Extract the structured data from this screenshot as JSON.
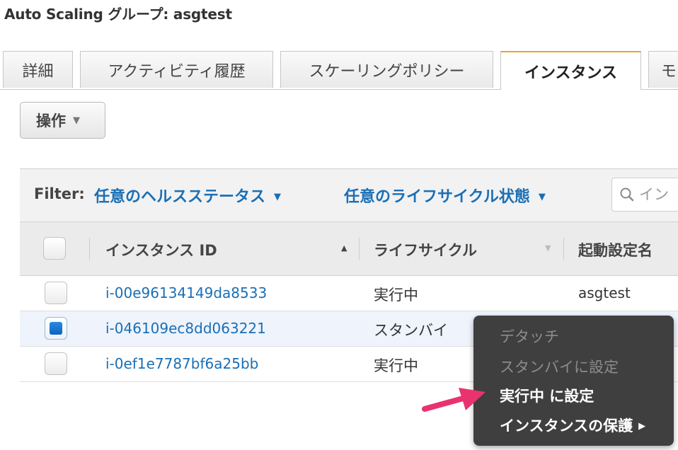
{
  "page": {
    "title": "Auto Scaling グループ: asgtest"
  },
  "tabs": [
    {
      "label": "詳細",
      "active": false
    },
    {
      "label": "アクティビティ履歴",
      "active": false
    },
    {
      "label": "スケーリングポリシー",
      "active": false
    },
    {
      "label": "インスタンス",
      "active": true
    },
    {
      "label": "モ",
      "active": false
    }
  ],
  "toolbar": {
    "actions_label": "操作"
  },
  "filter": {
    "label": "Filter:",
    "health_status": "任意のヘルスステータス",
    "lifecycle_state": "任意のライフサイクル状態",
    "search_placeholder": "イン"
  },
  "table": {
    "columns": [
      "インスタンス ID",
      "ライフサイクル",
      "起動設定名"
    ],
    "rows": [
      {
        "instance_id": "i-00e96134149da8533",
        "lifecycle": "実行中",
        "launch_config": "asgtest",
        "checked": false
      },
      {
        "instance_id": "i-046109ec8dd063221",
        "lifecycle": "スタンバイ",
        "launch_config": "",
        "checked": true
      },
      {
        "instance_id": "i-0ef1e7787bf6a25bb",
        "lifecycle": "実行中",
        "launch_config": "",
        "checked": false
      }
    ]
  },
  "context_menu": {
    "items": [
      {
        "label": "デタッチ",
        "enabled": false
      },
      {
        "label": "スタンバイに設定",
        "enabled": false
      },
      {
        "label": "実行中 に設定",
        "enabled": true
      },
      {
        "label": "インスタンスの保護",
        "enabled": true,
        "submenu": true
      }
    ]
  },
  "colors": {
    "link": "#1a6fb5",
    "active_tab_accent": "#f0a030",
    "checkbox_checked": "#0d62c0",
    "menu_background": "#3f3f3f",
    "annotation_arrow": "#e8336f"
  },
  "icons": {
    "search": "search-icon",
    "dropdown": "chevron-down-icon",
    "sort_asc": "sort-ascending-icon",
    "sort_desc": "sort-descending-icon",
    "submenu": "chevron-right-icon",
    "annotation": "pointer-arrow-icon"
  }
}
